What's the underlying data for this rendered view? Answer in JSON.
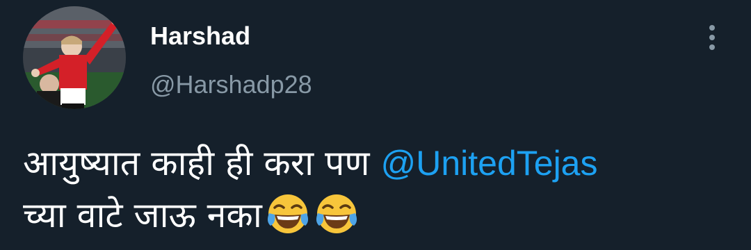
{
  "tweet": {
    "display_name": "Harshad",
    "handle": "@Harshadp28",
    "text_line1_prefix": "आयुष्यात काही ही करा पण ",
    "mention": "@UnitedTejas",
    "text_line2": "च्या वाटे जाऊ नका",
    "emoji": [
      "face-with-tears-of-joy-icon",
      "face-with-tears-of-joy-icon"
    ]
  },
  "colors": {
    "background": "#15202b",
    "name": "#ffffff",
    "handle": "#8899a6",
    "mention": "#1da1f2",
    "text": "#ffffff"
  }
}
